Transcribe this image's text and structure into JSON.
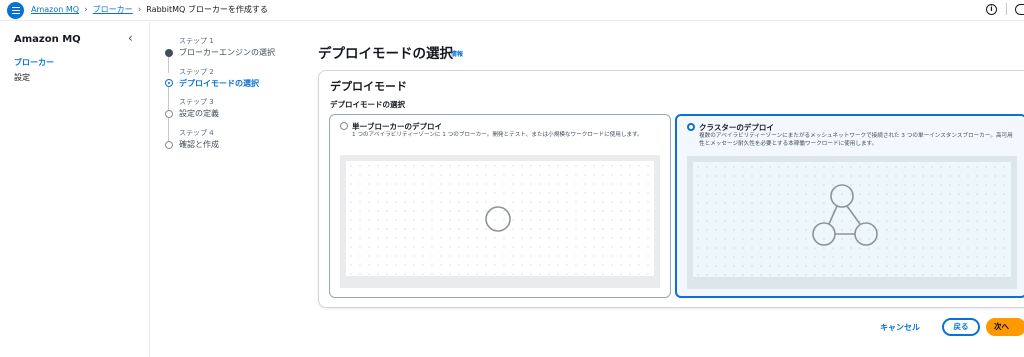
{
  "breadcrumb": {
    "items": [
      "Amazon MQ",
      "ブローカー"
    ],
    "current": "RabbitMQ ブローカーを作成する"
  },
  "sidebar": {
    "title": "Amazon MQ",
    "items": [
      {
        "label": "ブローカー",
        "active": true
      },
      {
        "label": "設定",
        "active": false
      }
    ]
  },
  "steps": [
    {
      "number": "ステップ 1",
      "label": "ブローカーエンジンの選択",
      "state": "completed"
    },
    {
      "number": "ステップ 2",
      "label": "デプロイモードの選択",
      "state": "current"
    },
    {
      "number": "ステップ 3",
      "label": "設定の定義",
      "state": "pending"
    },
    {
      "number": "ステップ 4",
      "label": "確認と作成",
      "state": "pending"
    }
  ],
  "main": {
    "title": "デプロイモードの選択",
    "info_link": "情報",
    "panel": {
      "title": "デプロイモード",
      "field_label": "デプロイモードの選択",
      "options": [
        {
          "title": "単一ブローカーのデプロイ",
          "description": "1 つのアベイラビリティーゾーンに 1 つのブローカー。開発とテスト、または小規模なワークロードに使用します。",
          "selected": false
        },
        {
          "title": "クラスターのデプロイ",
          "description": "複数のアベイラビリティーゾーンにまたがるメッシュネットワークで接続された 3 つの単一インスタンスブローカー。高可用性とメッセージ耐久性を必要とする本稼働ワークロードに使用します。",
          "selected": true
        }
      ]
    }
  },
  "footer": {
    "cancel": "キャンセル",
    "back": "戻る",
    "next": "次へ"
  },
  "colors": {
    "accent": "#0972d3",
    "primary_button": "#ff9900",
    "border": "#9ba7b6"
  },
  "icons": [
    "menu-icon",
    "info-icon",
    "settings-icon",
    "collapse-icon"
  ]
}
